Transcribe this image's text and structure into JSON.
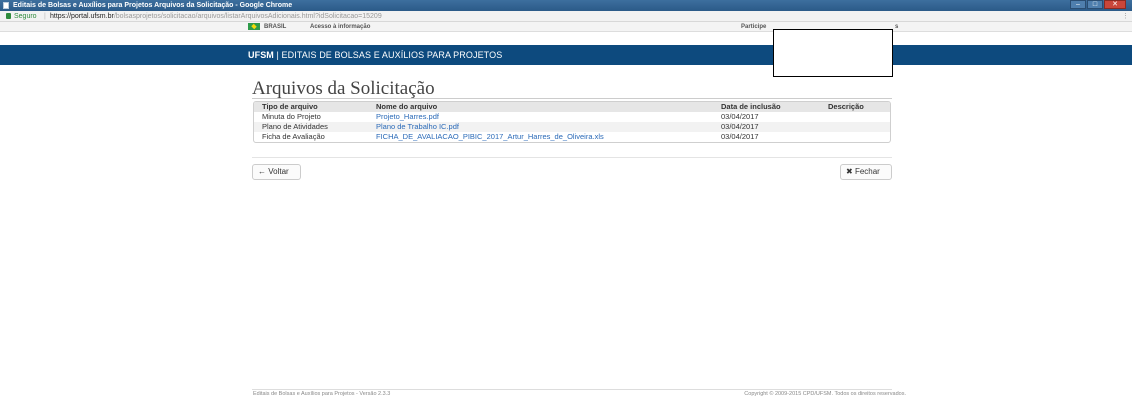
{
  "browser": {
    "window_title": "Editais de Bolsas e Auxílios para Projetos Arquivos da Solicitação - Google Chrome",
    "secure_label": "Seguro",
    "url_host": "https://portal.ufsm.br",
    "url_path": "/bolsasprojetos/solicitacao/arquivos/listarArquivosAdicionais.html?idSolicitacao=15209",
    "window_buttons": [
      "–",
      "□",
      "✕"
    ],
    "menu_glyph": "⋮"
  },
  "gov_bar": {
    "brasil": "BRASIL",
    "acesso": "Acesso à informação",
    "participe": "Participe",
    "end_glyph": "s"
  },
  "header": {
    "brand": "UFSM",
    "title": "| EDITAIS DE BOLSAS E AUXÍLIOS PARA PROJETOS"
  },
  "page": {
    "title": "Arquivos da Solicitação"
  },
  "table": {
    "columns": [
      "Tipo de arquivo",
      "Nome do arquivo",
      "Data de inclusão",
      "Descrição"
    ],
    "rows": [
      {
        "tipo": "Minuta do Projeto",
        "nome": "Projeto_Harres.pdf",
        "data": "03/04/2017",
        "descricao": ""
      },
      {
        "tipo": "Plano de Atividades",
        "nome": "Plano de Trabalho IC.pdf",
        "data": "03/04/2017",
        "descricao": ""
      },
      {
        "tipo": "Ficha de Avaliação",
        "nome": "FICHA_DE_AVALIACAO_PIBIC_2017_Artur_Harres_de_Oliveira.xls",
        "data": "03/04/2017",
        "descricao": ""
      }
    ]
  },
  "buttons": {
    "voltar": "Voltar",
    "voltar_icon": "←",
    "fechar": "Fechar",
    "fechar_icon": "✖"
  },
  "footer": {
    "left": "Editais de Bolsas e Auxílios para Projetos - Versão 2.3.3",
    "right": "Copyright © 2009-2015 CPD/UFSM. Todos os direitos reservados."
  }
}
